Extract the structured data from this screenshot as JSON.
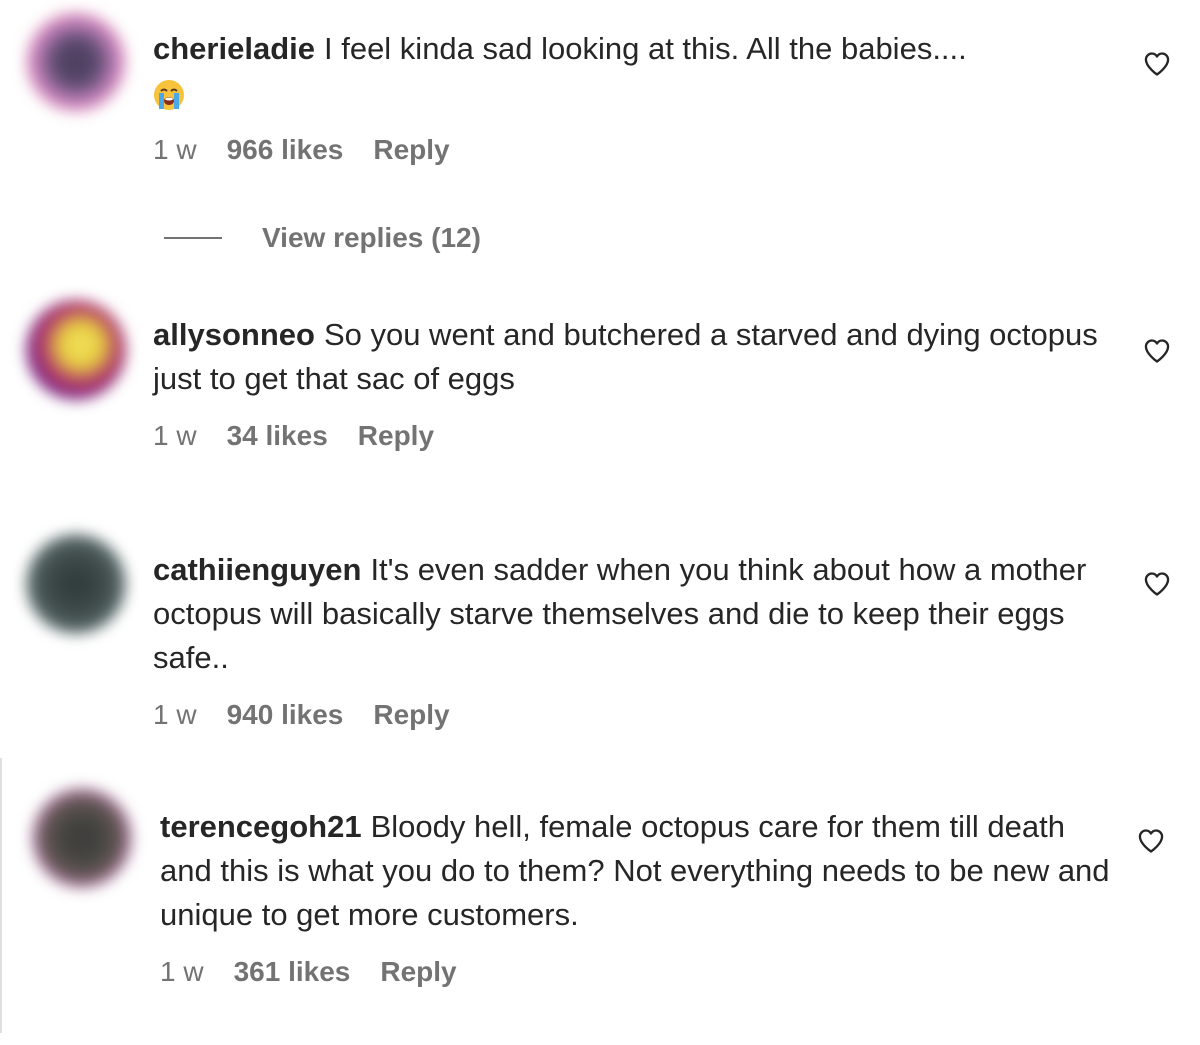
{
  "comments": [
    {
      "username": "cherieladie",
      "text": "I feel kinda sad looking at this. All the babies....",
      "emoji": "😭",
      "time": "1 w",
      "likes": "966 likes",
      "reply": "Reply",
      "view_replies": "View replies (12)"
    },
    {
      "username": "allysonneo",
      "text": "So you went and butchered a starved and dying octopus just to get that sac of eggs",
      "time": "1 w",
      "likes": "34 likes",
      "reply": "Reply"
    },
    {
      "username": "cathiienguyen",
      "text": "It's even sadder when you think about how a mother octopus will basically starve themselves and die to keep their eggs safe..",
      "time": "1 w",
      "likes": "940 likes",
      "reply": "Reply"
    },
    {
      "username": "terencegoh21",
      "text": "Bloody hell, female octopus care for them till death and this is what you do to them? Not everything needs to be new and unique to get more customers.",
      "time": "1 w",
      "likes": "361 likes",
      "reply": "Reply"
    }
  ],
  "icons": {
    "heart": "heart-outline-icon",
    "emoji": "loudly-crying-face-emoji"
  },
  "colors": {
    "text": "#262626",
    "secondary": "#737373"
  }
}
